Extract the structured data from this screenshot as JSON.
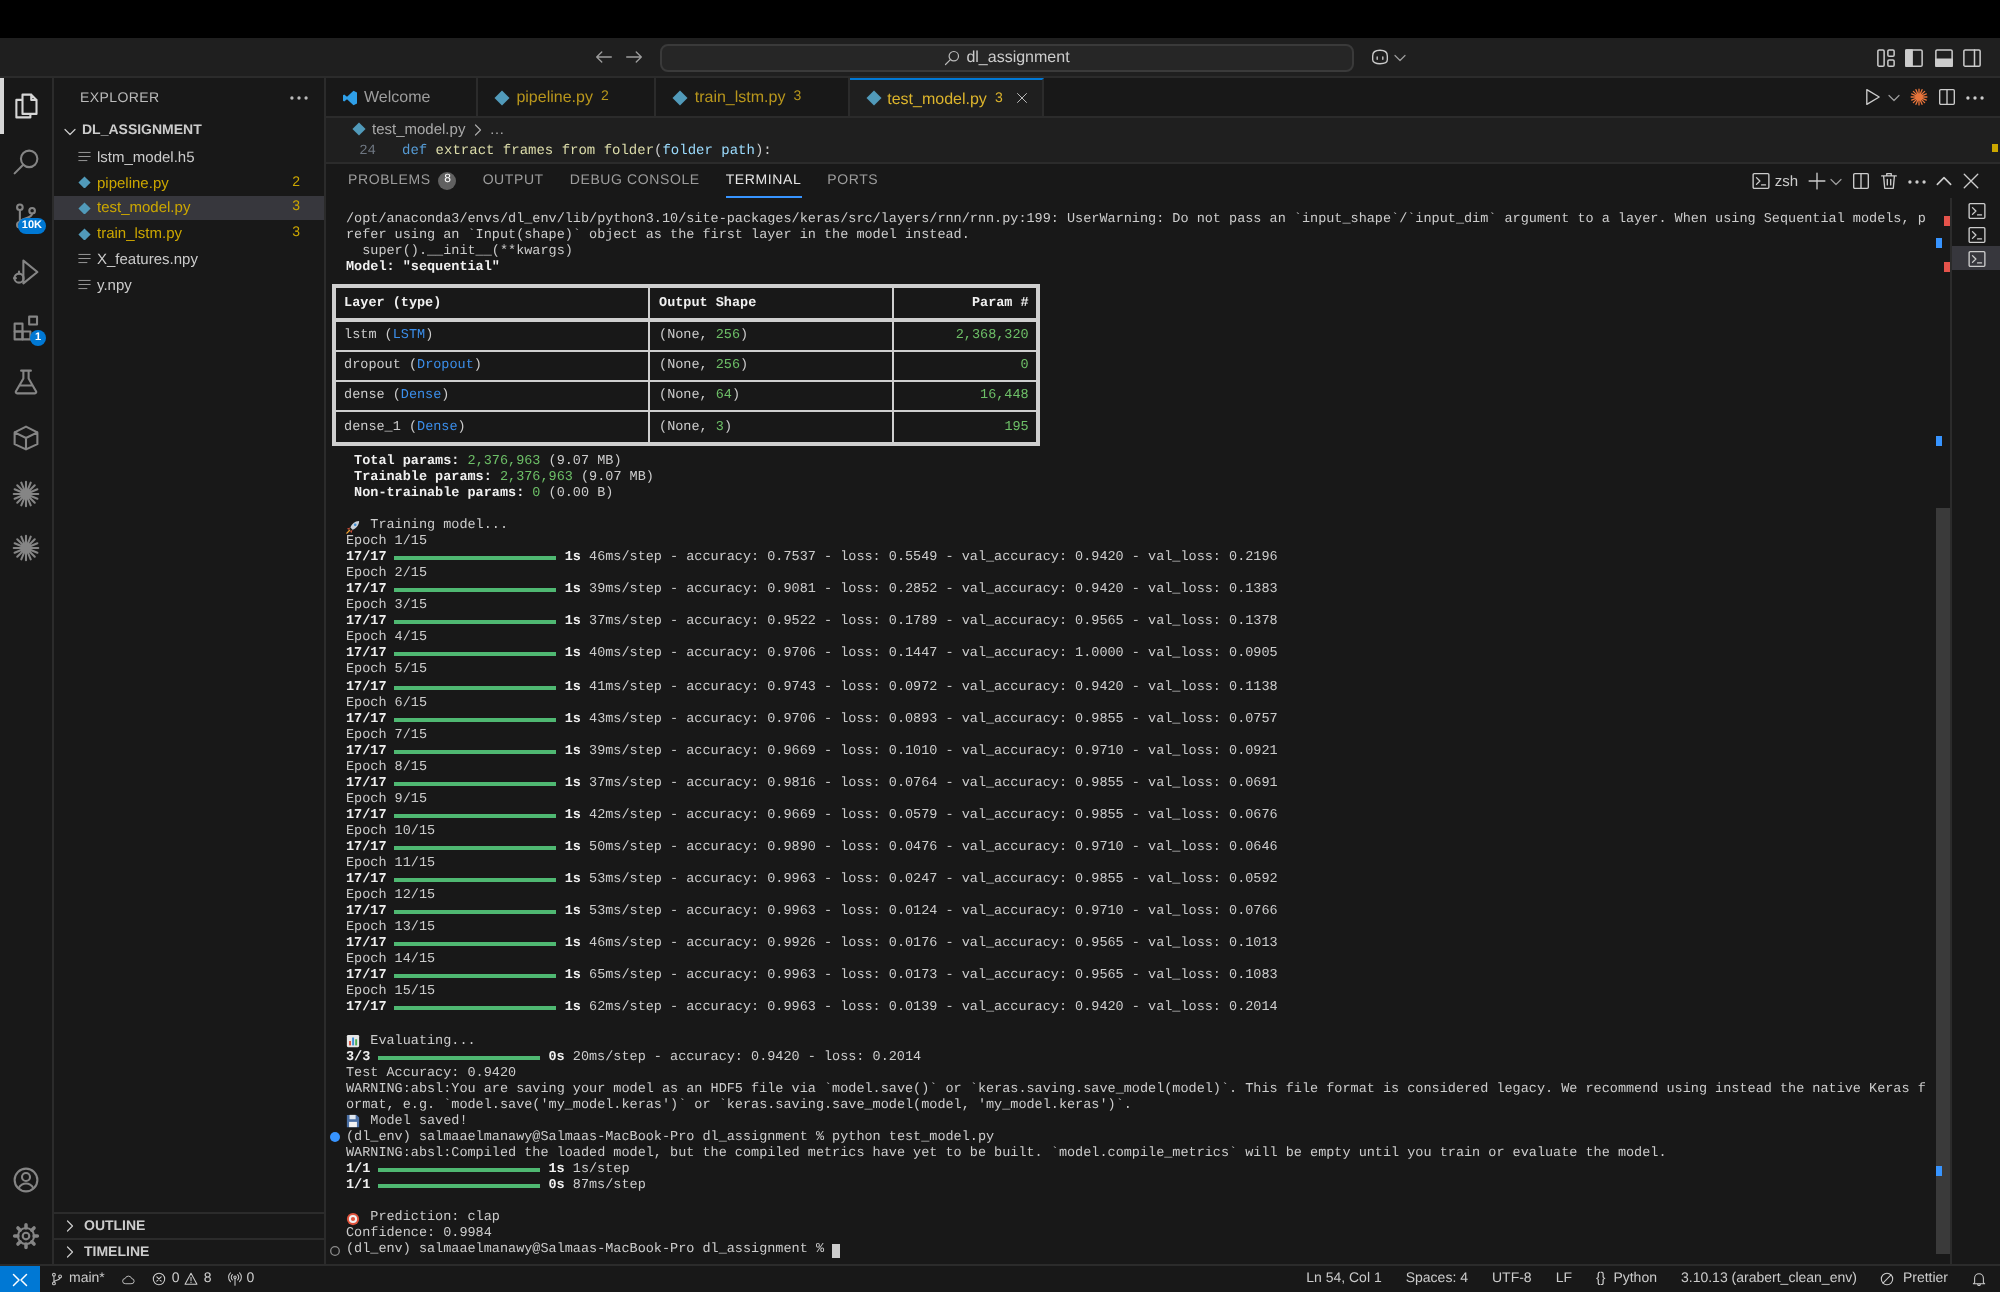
{
  "title_bar": {
    "search_text": "dl_assignment"
  },
  "activity_bar": {
    "top": [
      {
        "kind": "explorer",
        "selected": true
      },
      {
        "kind": "search",
        "selected": false
      },
      {
        "kind": "source-control",
        "selected": false,
        "badge": "10K"
      },
      {
        "kind": "run-debug",
        "selected": false
      },
      {
        "kind": "extensions",
        "selected": false,
        "badge": "1"
      },
      {
        "kind": "testing",
        "selected": false
      },
      {
        "kind": "cube",
        "selected": false
      },
      {
        "kind": "spark",
        "selected": false
      },
      {
        "kind": "spark",
        "selected": false
      }
    ],
    "bottom": [
      {
        "kind": "account"
      },
      {
        "kind": "settings"
      }
    ]
  },
  "sidebar": {
    "title": "EXPLORER",
    "folder": {
      "name": "DL_ASSIGNMENT",
      "expanded": true,
      "children": [
        {
          "name": "lstm_model.h5",
          "kind": "data",
          "selected": false,
          "warning": false
        },
        {
          "name": "pipeline.py",
          "kind": "python",
          "selected": false,
          "warning": true,
          "count": "2"
        },
        {
          "name": "test_model.py",
          "kind": "python",
          "selected": true,
          "warning": true,
          "count": "3"
        },
        {
          "name": "train_lstm.py",
          "kind": "python",
          "selected": false,
          "warning": true,
          "count": "3"
        },
        {
          "name": "X_features.npy",
          "kind": "data",
          "selected": false,
          "warning": false
        },
        {
          "name": "y.npy",
          "kind": "data",
          "selected": false,
          "warning": false
        }
      ]
    },
    "sections": [
      {
        "label": "OUTLINE",
        "expanded": false
      },
      {
        "label": "TIMELINE",
        "expanded": false
      }
    ]
  },
  "editor": {
    "tabs": [
      {
        "label": "Welcome",
        "kind": "welcome",
        "selected": false,
        "warning": false
      },
      {
        "label": "pipeline.py",
        "kind": "python",
        "selected": false,
        "warning": true,
        "count": "2"
      },
      {
        "label": "train_lstm.py",
        "kind": "python",
        "selected": false,
        "warning": true,
        "count": "3"
      },
      {
        "label": "test_model.py",
        "kind": "python",
        "selected": true,
        "warning": true,
        "count": "3"
      }
    ],
    "breadcrumb": [
      {
        "label": "test_model.py",
        "kind": "python"
      },
      {
        "label": "…",
        "kind": "symbol"
      }
    ],
    "code_line": {
      "number": "24",
      "tokens": [
        {
          "text": "def",
          "kind": "keyword"
        },
        {
          "text": " extract frames from folder",
          "kind": "function"
        },
        {
          "text": "(",
          "kind": "plain"
        },
        {
          "text": "folder path",
          "kind": "parameter"
        },
        {
          "text": "):",
          "kind": "plain"
        }
      ]
    },
    "overview_markers": [
      {
        "color": "#cca700"
      }
    ]
  },
  "panel": {
    "tabs": [
      {
        "label": "PROBLEMS",
        "badge": "8",
        "selected": false
      },
      {
        "label": "OUTPUT",
        "selected": false
      },
      {
        "label": "DEBUG CONSOLE",
        "selected": false
      },
      {
        "label": "TERMINAL",
        "selected": true
      },
      {
        "label": "PORTS",
        "selected": false
      }
    ],
    "terminal_name": "zsh",
    "terminal_list": [
      {
        "selected": false
      },
      {
        "selected": false
      },
      {
        "selected": true
      }
    ],
    "scroll_markers": [
      {
        "color": "#e5534b"
      },
      {
        "color": "#3794ff"
      },
      {
        "color": "#e5534b"
      },
      {
        "color": "#3794ff"
      },
      {
        "color": "#3794ff"
      }
    ],
    "terminal": {
      "lines": [
        {
          "kind": "text",
          "spans": [
            {
              "text": "/opt/anaconda3/envs/dl_env/lib/python3.10/site-packages/keras/src/layers/rnn/rnn.py:199: UserWarning: Do not pass an `input_shape`/`input_dim` argument to a layer. When using Sequential models, p",
              "kind": "plain"
            }
          ]
        },
        {
          "kind": "text",
          "spans": [
            {
              "text": "refer using an `Input(shape)` object as the first layer in the model instead.",
              "kind": "plain"
            }
          ]
        },
        {
          "kind": "text",
          "spans": [
            {
              "text": "  super().__init__(**kwargs)",
              "kind": "plain"
            }
          ]
        },
        {
          "kind": "text",
          "spans": [
            {
              "text": "Model: \"sequential\"",
              "kind": "bold"
            }
          ]
        },
        {
          "kind": "table",
          "columns": [
            "Layer (type)",
            "Output Shape",
            "Param #"
          ],
          "rows": [
            {
              "cells": [
                [
                  {
                    "text": "lstm (",
                    "kind": "plain"
                  },
                  {
                    "text": "LSTM",
                    "kind": "type"
                  },
                  {
                    "text": ")",
                    "kind": "plain"
                  }
                ],
                [
                  {
                    "text": "(None, ",
                    "kind": "plain"
                  },
                  {
                    "text": "256",
                    "kind": "number"
                  },
                  {
                    "text": ")",
                    "kind": "plain"
                  }
                ],
                [
                  {
                    "text": "2,368,320",
                    "kind": "number"
                  }
                ]
              ]
            },
            {
              "cells": [
                [
                  {
                    "text": "dropout (",
                    "kind": "plain"
                  },
                  {
                    "text": "Dropout",
                    "kind": "type"
                  },
                  {
                    "text": ")",
                    "kind": "plain"
                  }
                ],
                [
                  {
                    "text": "(None, ",
                    "kind": "plain"
                  },
                  {
                    "text": "256",
                    "kind": "number"
                  },
                  {
                    "text": ")",
                    "kind": "plain"
                  }
                ],
                [
                  {
                    "text": "0",
                    "kind": "number"
                  }
                ]
              ]
            },
            {
              "cells": [
                [
                  {
                    "text": "dense (",
                    "kind": "plain"
                  },
                  {
                    "text": "Dense",
                    "kind": "type"
                  },
                  {
                    "text": ")",
                    "kind": "plain"
                  }
                ],
                [
                  {
                    "text": "(None, ",
                    "kind": "plain"
                  },
                  {
                    "text": "64",
                    "kind": "number"
                  },
                  {
                    "text": ")",
                    "kind": "plain"
                  }
                ],
                [
                  {
                    "text": "16,448",
                    "kind": "number"
                  }
                ]
              ]
            },
            {
              "cells": [
                [
                  {
                    "text": "dense_1 (",
                    "kind": "plain"
                  },
                  {
                    "text": "Dense",
                    "kind": "type"
                  },
                  {
                    "text": ")",
                    "kind": "plain"
                  }
                ],
                [
                  {
                    "text": "(None, ",
                    "kind": "plain"
                  },
                  {
                    "text": "3",
                    "kind": "number"
                  },
                  {
                    "text": ")",
                    "kind": "plain"
                  }
                ],
                [
                  {
                    "text": "195",
                    "kind": "number"
                  }
                ]
              ]
            }
          ]
        },
        {
          "kind": "text",
          "spans": [
            {
              "text": " Total params:",
              "kind": "bold"
            },
            {
              "text": " 2,376,963",
              "kind": "number"
            },
            {
              "text": " (9.07 MB)",
              "kind": "plain"
            }
          ]
        },
        {
          "kind": "text",
          "spans": [
            {
              "text": " Trainable params:",
              "kind": "bold"
            },
            {
              "text": " 2,376,963",
              "kind": "number"
            },
            {
              "text": " (9.07 MB)",
              "kind": "plain"
            }
          ]
        },
        {
          "kind": "text",
          "spans": [
            {
              "text": " Non-trainable params:",
              "kind": "bold"
            },
            {
              "text": " 0",
              "kind": "number"
            },
            {
              "text": " (0.00 B)",
              "kind": "plain"
            }
          ]
        },
        {
          "kind": "blank"
        },
        {
          "kind": "rocket",
          "text": "Training model..."
        },
        {
          "kind": "text",
          "spans": [
            {
              "text": "Epoch 1/15",
              "kind": "plain"
            }
          ]
        },
        {
          "kind": "progress",
          "count": "17/17",
          "level": 1,
          "spans": [
            {
              "text": "1s",
              "kind": "bold"
            },
            {
              "text": " 46ms/step - accuracy: 0.7537 - loss: 0.5549 - val_accuracy: 0.9420 - val_loss: 0.2196",
              "kind": "plain"
            }
          ]
        },
        {
          "kind": "text",
          "spans": [
            {
              "text": "Epoch 2/15",
              "kind": "plain"
            }
          ]
        },
        {
          "kind": "progress",
          "count": "17/17",
          "level": 1,
          "spans": [
            {
              "text": "1s",
              "kind": "bold"
            },
            {
              "text": " 39ms/step - accuracy: 0.9081 - loss: 0.2852 - val_accuracy: 0.9420 - val_loss: 0.1383",
              "kind": "plain"
            }
          ]
        },
        {
          "kind": "text",
          "spans": [
            {
              "text": "Epoch 3/15",
              "kind": "plain"
            }
          ]
        },
        {
          "kind": "progress",
          "count": "17/17",
          "level": 1,
          "spans": [
            {
              "text": "1s",
              "kind": "bold"
            },
            {
              "text": " 37ms/step - accuracy: 0.9522 - loss: 0.1789 - val_accuracy: 0.9565 - val_loss: 0.1378",
              "kind": "plain"
            }
          ]
        },
        {
          "kind": "text",
          "spans": [
            {
              "text": "Epoch 4/15",
              "kind": "plain"
            }
          ]
        },
        {
          "kind": "progress",
          "count": "17/17",
          "level": 1,
          "spans": [
            {
              "text": "1s",
              "kind": "bold"
            },
            {
              "text": " 40ms/step - accuracy: 0.9706 - loss: 0.1447 - val_accuracy: 1.0000 - val_loss: 0.0905",
              "kind": "plain"
            }
          ]
        },
        {
          "kind": "text",
          "spans": [
            {
              "text": "Epoch 5/15",
              "kind": "plain"
            }
          ]
        },
        {
          "kind": "progress",
          "count": "17/17",
          "level": 1,
          "spans": [
            {
              "text": "1s",
              "kind": "bold"
            },
            {
              "text": " 41ms/step - accuracy: 0.9743 - loss: 0.0972 - val_accuracy: 0.9420 - val_loss: 0.1138",
              "kind": "plain"
            }
          ]
        },
        {
          "kind": "text",
          "spans": [
            {
              "text": "Epoch 6/15",
              "kind": "plain"
            }
          ]
        },
        {
          "kind": "progress",
          "count": "17/17",
          "level": 1,
          "spans": [
            {
              "text": "1s",
              "kind": "bold"
            },
            {
              "text": " 43ms/step - accuracy: 0.9706 - loss: 0.0893 - val_accuracy: 0.9855 - val_loss: 0.0757",
              "kind": "plain"
            }
          ]
        },
        {
          "kind": "text",
          "spans": [
            {
              "text": "Epoch 7/15",
              "kind": "plain"
            }
          ]
        },
        {
          "kind": "progress",
          "count": "17/17",
          "level": 1,
          "spans": [
            {
              "text": "1s",
              "kind": "bold"
            },
            {
              "text": " 39ms/step - accuracy: 0.9669 - loss: 0.1010 - val_accuracy: 0.9710 - val_loss: 0.0921",
              "kind": "plain"
            }
          ]
        },
        {
          "kind": "text",
          "spans": [
            {
              "text": "Epoch 8/15",
              "kind": "plain"
            }
          ]
        },
        {
          "kind": "progress",
          "count": "17/17",
          "level": 1,
          "spans": [
            {
              "text": "1s",
              "kind": "bold"
            },
            {
              "text": " 37ms/step - accuracy: 0.9816 - loss: 0.0764 - val_accuracy: 0.9855 - val_loss: 0.0691",
              "kind": "plain"
            }
          ]
        },
        {
          "kind": "text",
          "spans": [
            {
              "text": "Epoch 9/15",
              "kind": "plain"
            }
          ]
        },
        {
          "kind": "progress",
          "count": "17/17",
          "level": 1,
          "spans": [
            {
              "text": "1s",
              "kind": "bold"
            },
            {
              "text": " 42ms/step - accuracy: 0.9669 - loss: 0.0579 - val_accuracy: 0.9855 - val_loss: 0.0676",
              "kind": "plain"
            }
          ]
        },
        {
          "kind": "text",
          "spans": [
            {
              "text": "Epoch 10/15",
              "kind": "plain"
            }
          ]
        },
        {
          "kind": "progress",
          "count": "17/17",
          "level": 1,
          "spans": [
            {
              "text": "1s",
              "kind": "bold"
            },
            {
              "text": " 50ms/step - accuracy: 0.9890 - loss: 0.0476 - val_accuracy: 0.9710 - val_loss: 0.0646",
              "kind": "plain"
            }
          ]
        },
        {
          "kind": "text",
          "spans": [
            {
              "text": "Epoch 11/15",
              "kind": "plain"
            }
          ]
        },
        {
          "kind": "progress",
          "count": "17/17",
          "level": 1,
          "spans": [
            {
              "text": "1s",
              "kind": "bold"
            },
            {
              "text": " 53ms/step - accuracy: 0.9963 - loss: 0.0247 - val_accuracy: 0.9855 - val_loss: 0.0592",
              "kind": "plain"
            }
          ]
        },
        {
          "kind": "text",
          "spans": [
            {
              "text": "Epoch 12/15",
              "kind": "plain"
            }
          ]
        },
        {
          "kind": "progress",
          "count": "17/17",
          "level": 1,
          "spans": [
            {
              "text": "1s",
              "kind": "bold"
            },
            {
              "text": " 53ms/step - accuracy: 0.9963 - loss: 0.0124 - val_accuracy: 0.9710 - val_loss: 0.0766",
              "kind": "plain"
            }
          ]
        },
        {
          "kind": "text",
          "spans": [
            {
              "text": "Epoch 13/15",
              "kind": "plain"
            }
          ]
        },
        {
          "kind": "progress",
          "count": "17/17",
          "level": 1,
          "spans": [
            {
              "text": "1s",
              "kind": "bold"
            },
            {
              "text": " 46ms/step - accuracy: 0.9926 - loss: 0.0176 - val_accuracy: 0.9565 - val_loss: 0.1013",
              "kind": "plain"
            }
          ]
        },
        {
          "kind": "text",
          "spans": [
            {
              "text": "Epoch 14/15",
              "kind": "plain"
            }
          ]
        },
        {
          "kind": "progress",
          "count": "17/17",
          "level": 1,
          "spans": [
            {
              "text": "1s",
              "kind": "bold"
            },
            {
              "text": " 65ms/step - accuracy: 0.9963 - loss: 0.0173 - val_accuracy: 0.9565 - val_loss: 0.1083",
              "kind": "plain"
            }
          ]
        },
        {
          "kind": "text",
          "spans": [
            {
              "text": "Epoch 15/15",
              "kind": "plain"
            }
          ]
        },
        {
          "kind": "progress",
          "count": "17/17",
          "level": 1,
          "spans": [
            {
              "text": "1s",
              "kind": "bold"
            },
            {
              "text": " 62ms/step - accuracy: 0.9963 - loss: 0.0139 - val_accuracy: 0.9420 - val_loss: 0.2014",
              "kind": "plain"
            }
          ]
        },
        {
          "kind": "blank"
        },
        {
          "kind": "chart",
          "text": "Evaluating..."
        },
        {
          "kind": "progress",
          "count": "3/3",
          "level": 1,
          "spans": [
            {
              "text": "0s",
              "kind": "bold"
            },
            {
              "text": " 20ms/step - accuracy: 0.9420 - loss: 0.2014",
              "kind": "plain"
            }
          ]
        },
        {
          "kind": "text",
          "spans": [
            {
              "text": "Test Accuracy: 0.9420",
              "kind": "plain"
            }
          ]
        },
        {
          "kind": "text",
          "spans": [
            {
              "text": "WARNING:absl:You are saving your model as an HDF5 file via `model.save()` or `keras.saving.save_model(model)`. This file format is considered legacy. We recommend using instead the native Keras f",
              "kind": "plain"
            }
          ]
        },
        {
          "kind": "text",
          "spans": [
            {
              "text": "ormat, e.g. `model.save('my_model.keras')` or `keras.saving.save_model(model, 'my_model.keras')`.",
              "kind": "plain"
            }
          ]
        },
        {
          "kind": "floppy",
          "text": "Model saved!"
        },
        {
          "kind": "prompt",
          "finished": true,
          "cursor": false,
          "text": "(dl_env) salmaaelmanawy@Salmaas-MacBook-Pro dl_assignment % python test_model.py"
        },
        {
          "kind": "text",
          "spans": [
            {
              "text": "WARNING:absl:Compiled the loaded model, but the compiled metrics have yet to be built. `model.compile_metrics` will be empty until you train or evaluate the model.",
              "kind": "plain"
            }
          ]
        },
        {
          "kind": "progress",
          "count": "1/1",
          "level": 1,
          "spans": [
            {
              "text": "1s",
              "kind": "bold"
            },
            {
              "text": " 1s/step",
              "kind": "plain"
            }
          ]
        },
        {
          "kind": "progress",
          "count": "1/1",
          "level": 1,
          "spans": [
            {
              "text": "0s",
              "kind": "bold"
            },
            {
              "text": " 87ms/step",
              "kind": "plain"
            }
          ]
        },
        {
          "kind": "blank"
        },
        {
          "kind": "target",
          "text": "Prediction: clap"
        },
        {
          "kind": "text",
          "spans": [
            {
              "text": "Confidence: 0.9984",
              "kind": "plain"
            }
          ]
        },
        {
          "kind": "prompt",
          "finished": false,
          "cursor": true,
          "text": "(dl_env) salmaaelmanawy@Salmaas-MacBook-Pro dl_assignment %"
        }
      ]
    }
  },
  "status_bar": {
    "branch": "main*",
    "errors": "0",
    "warnings": "8",
    "ports": "0",
    "right": [
      {
        "kind": "text",
        "text": "Ln 54, Col 1"
      },
      {
        "kind": "text",
        "text": "Spaces: 4"
      },
      {
        "kind": "text",
        "text": "UTF-8"
      },
      {
        "kind": "text",
        "text": "LF"
      },
      {
        "kind": "language",
        "glyph": "{}",
        "text": "Python"
      },
      {
        "kind": "text",
        "text": "3.10.13 (arabert_clean_env)"
      },
      {
        "kind": "formatter",
        "text": "Prettier"
      },
      {
        "kind": "bell"
      }
    ]
  }
}
